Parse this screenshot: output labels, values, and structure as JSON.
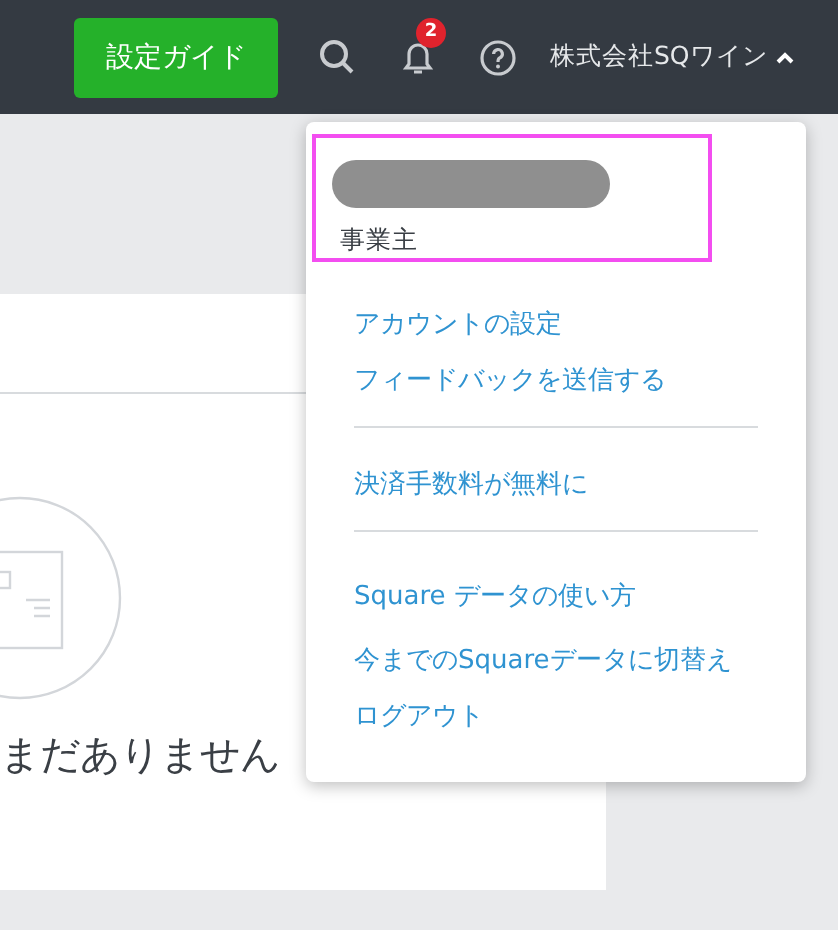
{
  "topbar": {
    "setup_button": "設定ガイド",
    "notifications": {
      "badge": "2"
    },
    "account": {
      "name": "株式会社SQワイン",
      "expanded": true
    }
  },
  "empty_state": {
    "message": "まだありません"
  },
  "account_menu": {
    "role": "事業主",
    "groups": [
      {
        "items": [
          "アカウントの設定",
          "フィードバックを送信する"
        ]
      },
      {
        "items": [
          "決済手数料が無料に"
        ]
      },
      {
        "items": [
          "Square データの使い方",
          "今までのSquareデータに切替え",
          "ログアウト"
        ]
      }
    ]
  }
}
